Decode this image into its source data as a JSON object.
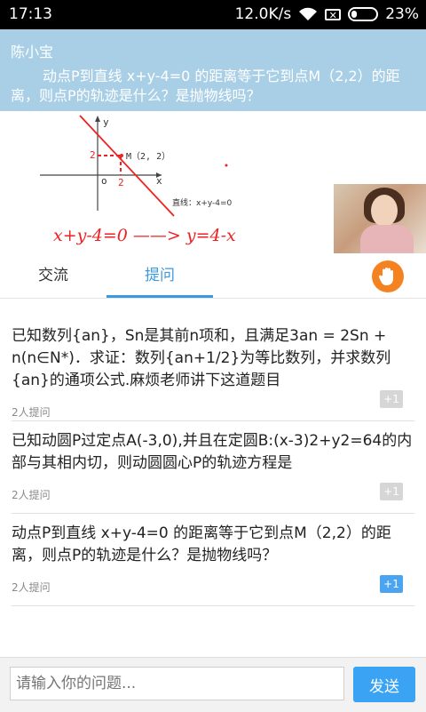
{
  "status_bar": {
    "time": "17:13",
    "network_speed": "12.0K/s",
    "sim_icon": "sim-x-icon",
    "battery": "23%",
    "battery_level": 0.23
  },
  "question_header": {
    "author": "陈小宝",
    "text": "动点P到直线 x+y-4=0 的距离等于它到点M（2,2）的距离，则点P的轨迹是什么？是抛物线吗？"
  },
  "whiteboard": {
    "axis_y": "y",
    "axis_x": "x",
    "origin": "o",
    "tick_y": "2",
    "tick_x": "2",
    "point_label": "M（2, 2）",
    "line_label": "直线：x+y-4=0",
    "handwriting": "x+y-4=0 ——> y=4-x"
  },
  "tabs": [
    {
      "label": "交流"
    },
    {
      "label": "提问"
    }
  ],
  "hand_button": {
    "icon": "raise-hand-icon",
    "color": "#f58220"
  },
  "questions": [
    {
      "text": "已知数列{an}，Sn是其前n项和，且满足3an = 2Sn + n(n∈N*)．求证：数列{an+1/2}为等比数列，并求数列{an}的通项公式.麻烦老师讲下这道题目",
      "meta": "2人提问",
      "plus": "+1",
      "active": false
    },
    {
      "text": "已知动圆P过定点A(-3,0),并且在定圆B:(x-3)2+y2=64的内部与其相内切，则动圆圆心P的轨迹方程是",
      "meta": "2人提问",
      "plus": "+1",
      "active": false
    },
    {
      "text": "动点P到直线 x+y-4=0 的距离等于它到点M（2,2）的距离，则点P的轨迹是什么？是抛物线吗？",
      "meta": "2人提问",
      "plus": "+1",
      "active": true
    }
  ],
  "input": {
    "placeholder": "请输入你的问题...",
    "value": "",
    "send_label": "发送"
  },
  "colors": {
    "accent": "#3a9ae0",
    "header_bg": "#a9cfe6",
    "plus_active": "#4aa4f0",
    "plus_inactive": "#d6d6d6"
  }
}
